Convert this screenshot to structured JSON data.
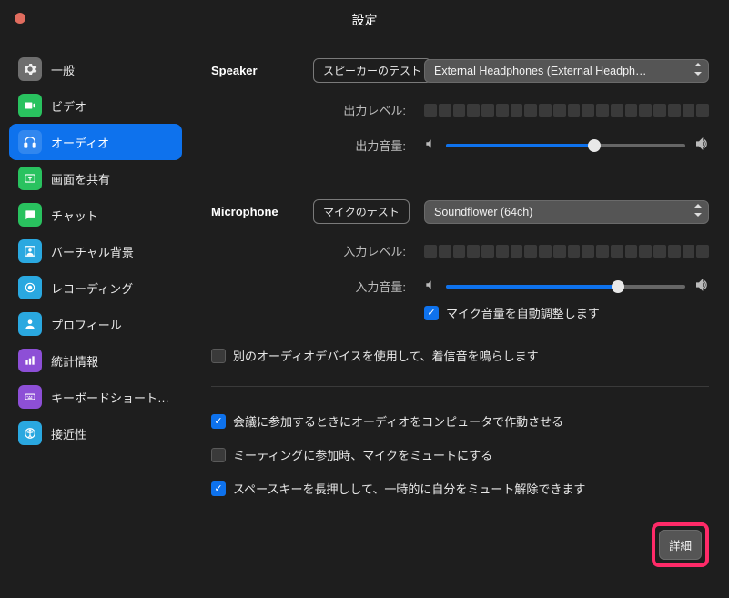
{
  "window": {
    "title": "設定"
  },
  "sidebar": {
    "items": [
      {
        "label": "一般"
      },
      {
        "label": "ビデオ"
      },
      {
        "label": "オーディオ"
      },
      {
        "label": "画面を共有"
      },
      {
        "label": "チャット"
      },
      {
        "label": "バーチャル背景"
      },
      {
        "label": "レコーディング"
      },
      {
        "label": "プロフィール"
      },
      {
        "label": "統計情報"
      },
      {
        "label": "キーボードショートカ…"
      },
      {
        "label": "接近性"
      }
    ]
  },
  "audio": {
    "speaker": {
      "heading": "Speaker",
      "test_label": "スピーカーのテスト",
      "device": "External Headphones (External Headph…",
      "output_level_label": "出力レベル:",
      "output_volume_label": "出力音量:",
      "volume_percent": 62
    },
    "microphone": {
      "heading": "Microphone",
      "test_label": "マイクのテスト",
      "device": "Soundflower (64ch)",
      "input_level_label": "入力レベル:",
      "input_volume_label": "入力音量:",
      "volume_percent": 72,
      "auto_adjust_label": "マイク音量を自動調整します"
    },
    "separate_ring_device_label": "別のオーディオデバイスを使用して、着信音を鳴らします",
    "options": {
      "join_with_audio_label": "会議に参加するときにオーディオをコンピュータで作動させる",
      "mute_on_join_label": "ミーティングに参加時、マイクをミュートにする",
      "space_unmute_label": "スペースキーを長押しして、一時的に自分をミュート解除できます"
    },
    "advanced_label": "詳細"
  },
  "colors": {
    "accent": "#0e72ed",
    "highlight": "#ff2a68"
  }
}
